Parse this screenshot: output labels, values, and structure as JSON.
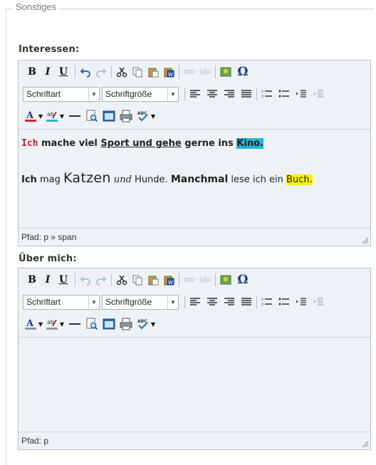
{
  "section": {
    "legend": "Sonstiges"
  },
  "toolbar_common": {
    "bold": "B",
    "italic": "I",
    "underline": "U",
    "font_select": "Schriftart",
    "size_select": "Schriftgröße",
    "omega": "Ω"
  },
  "editor1": {
    "label": "Interessen:",
    "line1": {
      "seg1": "Ich",
      "seg2": " mache viel ",
      "seg3": "Sport und gehe",
      "seg4": " gerne ins ",
      "seg5": "Kino."
    },
    "line2": {
      "seg1": "Ich",
      "seg2": " mag ",
      "seg3": "Katzen",
      "seg4": " und",
      "seg5": " Hunde. ",
      "seg6": "Manchmal",
      "seg7": "  lese ich ein ",
      "seg8": "Buch."
    },
    "path": "Pfad: p » span"
  },
  "editor2": {
    "label": "Über mich:",
    "path": "Pfad: p"
  },
  "colors": {
    "text_color_bar": "#e02020",
    "highlight_bar": "#22b5d6",
    "cyan_highlight": "#22b5d6",
    "yellow_highlight": "#f5f200",
    "red_text": "#b8232b"
  }
}
